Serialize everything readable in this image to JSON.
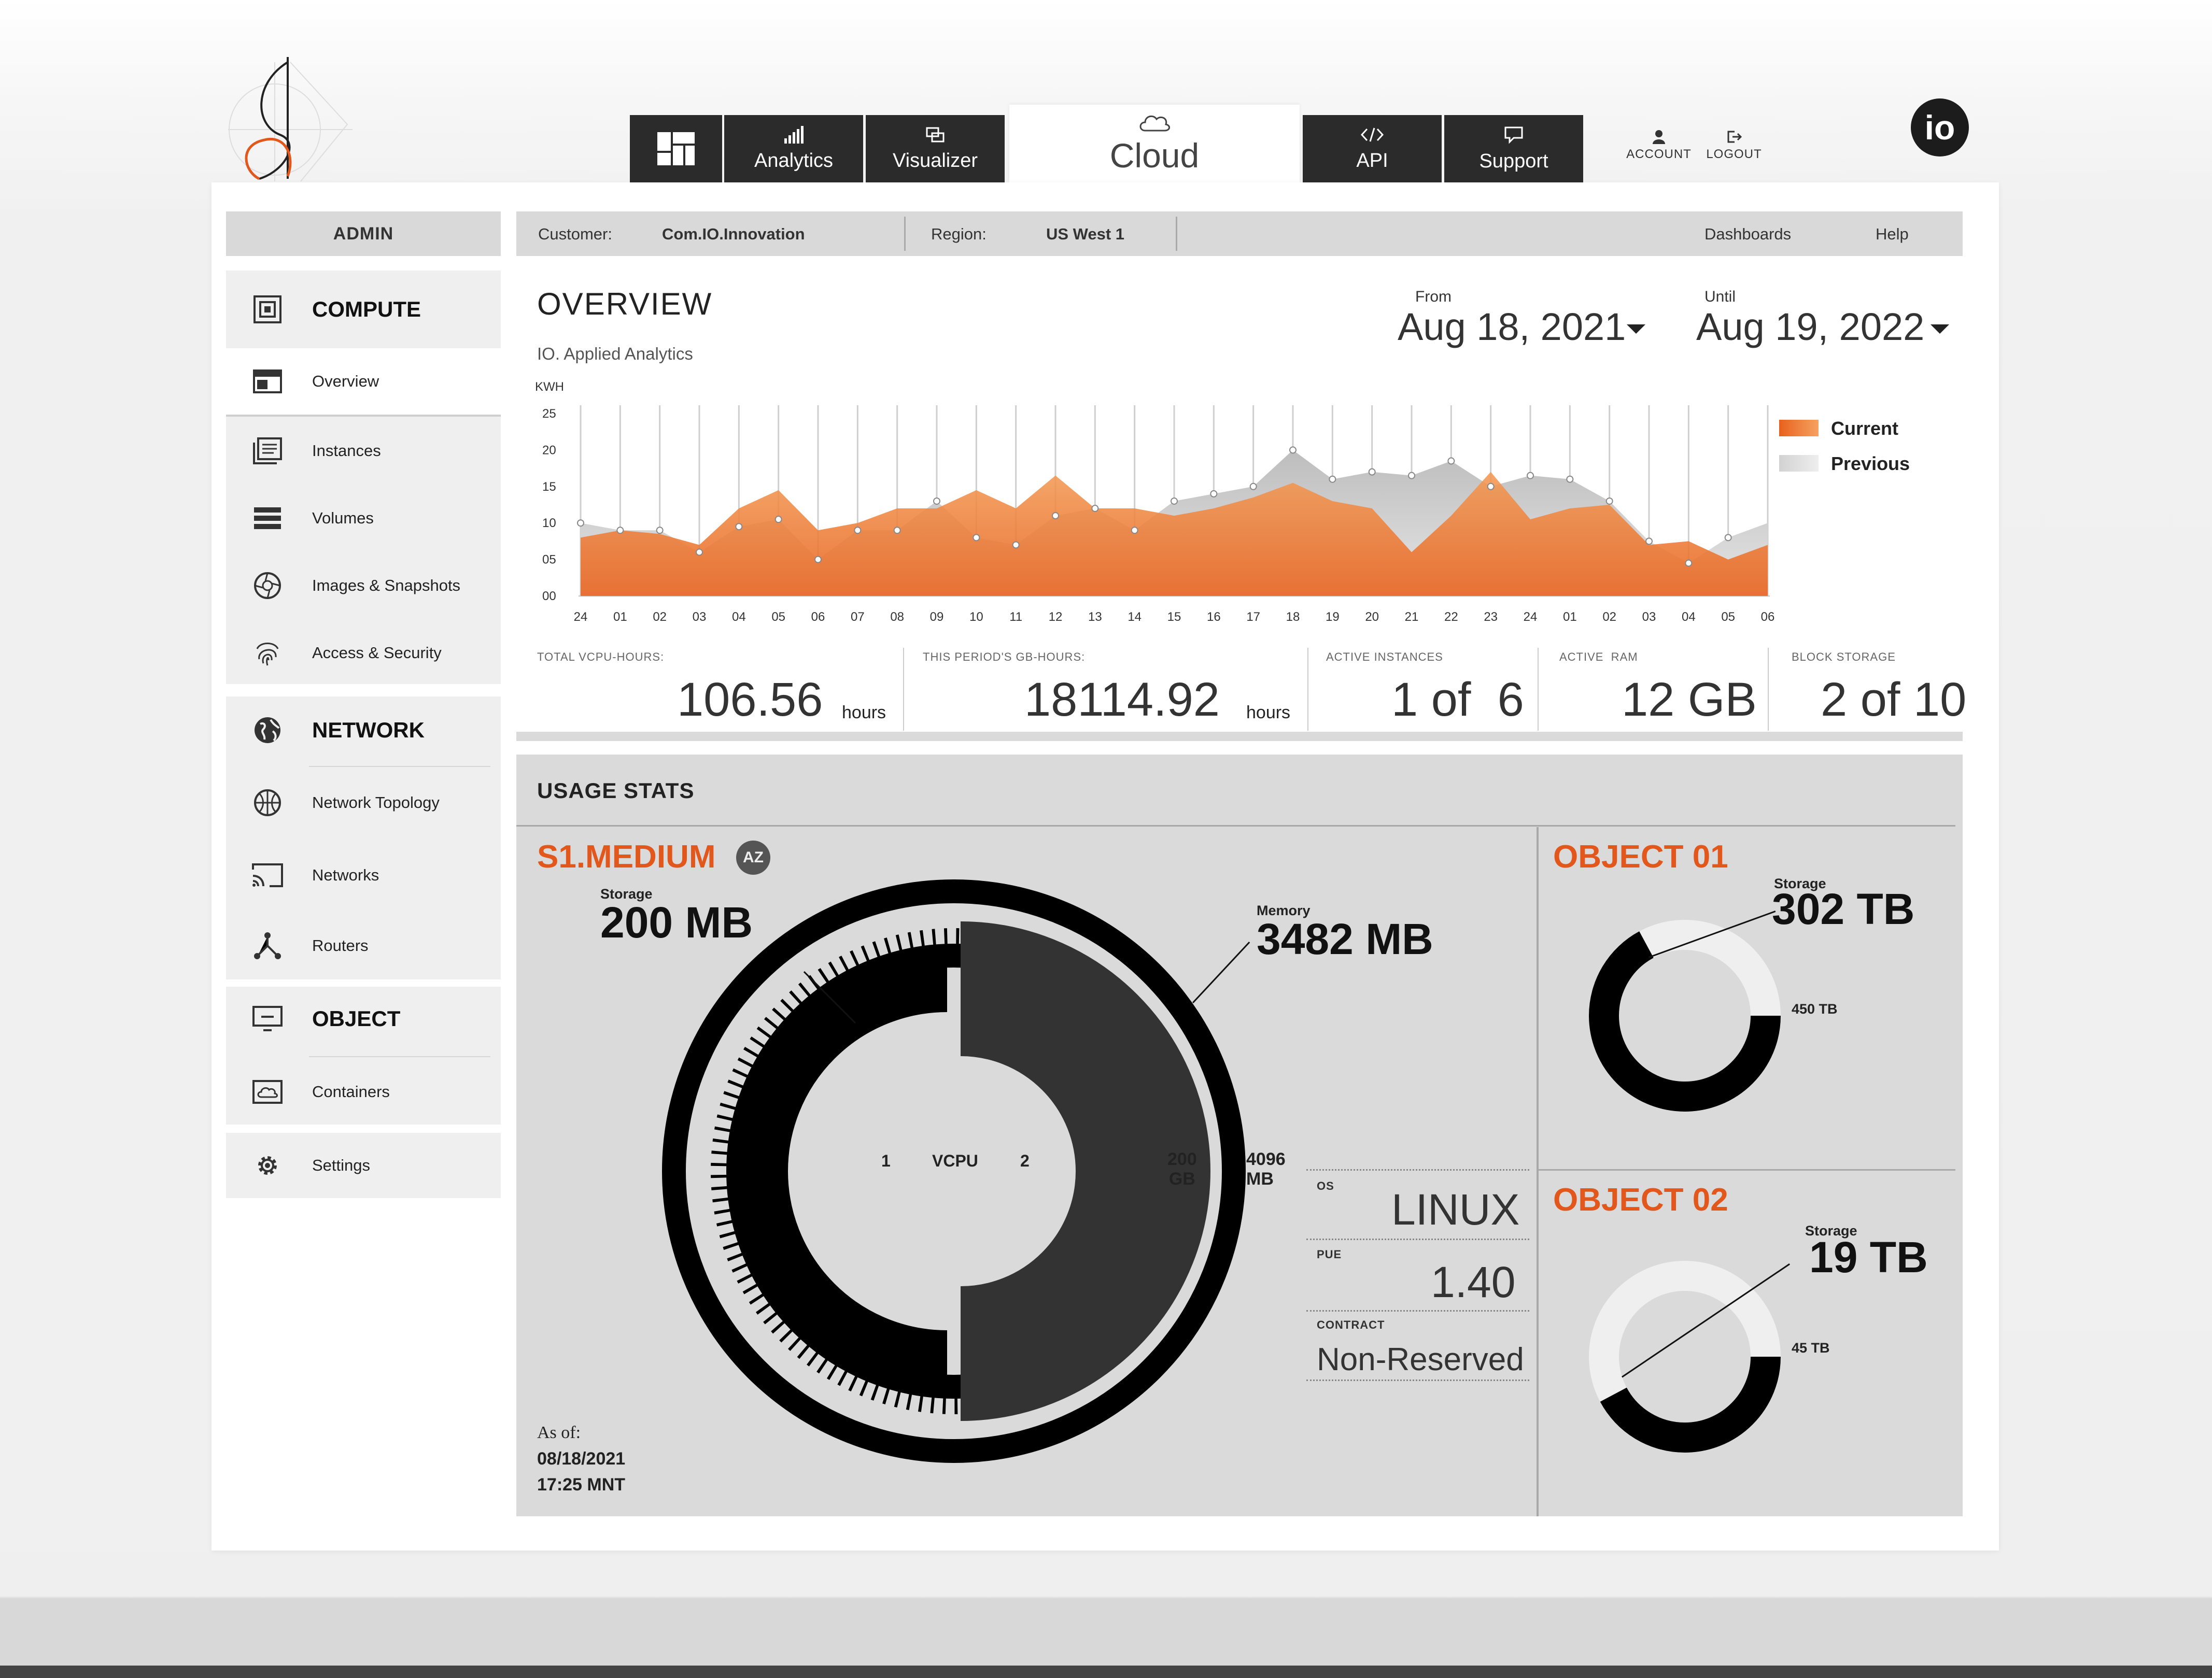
{
  "nav": {
    "tabs": [
      {
        "label": ""
      },
      {
        "label": "Analytics"
      },
      {
        "label": "Visualizer"
      },
      {
        "label": "Cloud"
      },
      {
        "label": "API"
      },
      {
        "label": "Support"
      }
    ],
    "account": "ACCOUNT",
    "logout": "LOGOUT",
    "brand_badge": "io"
  },
  "sidebar": {
    "header": "ADMIN",
    "compute": {
      "label": "COMPUTE",
      "items": [
        "Overview",
        "Instances",
        "Volumes",
        "Images & Snapshots",
        "Access & Security"
      ]
    },
    "network": {
      "label": "NETWORK",
      "items": [
        "Network Topology",
        "Networks",
        "Routers"
      ]
    },
    "object": {
      "label": "OBJECT",
      "items": [
        "Containers"
      ]
    },
    "settings": "Settings"
  },
  "infobar": {
    "customer_label": "Customer:",
    "customer_value": "Com.IO.Innovation",
    "region_label": "Region:",
    "region_value": "US West 1",
    "dashboards": "Dashboards",
    "help": "Help"
  },
  "overview": {
    "title": "OVERVIEW",
    "subtitle": "IO. Applied Analytics",
    "from_label": "From",
    "from_value": "Aug 18, 2021",
    "until_label": "Until",
    "until_value": "Aug 19, 2022"
  },
  "chart_data": {
    "type": "area",
    "ylabel": "KWH",
    "yticks": [
      "25",
      "20",
      "15",
      "10",
      "05",
      "00"
    ],
    "ylim": [
      0,
      25
    ],
    "x": [
      "24",
      "01",
      "02",
      "03",
      "04",
      "05",
      "06",
      "07",
      "08",
      "09",
      "10",
      "11",
      "12",
      "13",
      "14",
      "15",
      "16",
      "17",
      "18",
      "19",
      "20",
      "21",
      "22",
      "23",
      "24",
      "01",
      "02",
      "03",
      "04",
      "05",
      "06"
    ],
    "series": [
      {
        "name": "Current",
        "color": "#f07a2a",
        "values": [
          8,
          9,
          8.5,
          7,
          12,
          14.5,
          9,
          10,
          12,
          12,
          14.5,
          12,
          16.5,
          12,
          12,
          11,
          12,
          13.5,
          15.5,
          13,
          12,
          6,
          11,
          17,
          10.5,
          12,
          12.5,
          7,
          7.5,
          5,
          7
        ]
      },
      {
        "name": "Previous",
        "color": "#c9c9c9",
        "values": [
          10,
          9,
          9,
          6,
          9.5,
          10.5,
          5,
          9,
          9,
          13,
          8,
          7,
          11,
          12,
          9,
          13,
          14,
          15,
          20,
          16,
          17,
          16.5,
          18.5,
          15,
          16.5,
          16,
          13,
          7.5,
          4.5,
          8,
          10
        ]
      }
    ],
    "grid": true,
    "legend": "right"
  },
  "stats": [
    {
      "label": "TOTAL VCPU-HOURS:",
      "value": "106.56",
      "unit": "hours"
    },
    {
      "label": "THIS PERIOD'S GB-HOURS:",
      "value": "18114.92",
      "unit": "hours"
    },
    {
      "label": "ACTIVE INSTANCES",
      "value": "1 of  6",
      "unit": ""
    },
    {
      "label": "ACTIVE  RAM",
      "value": "12 GB",
      "unit": ""
    },
    {
      "label": "BLOCK STORAGE",
      "value": "2 of 10",
      "unit": ""
    }
  ],
  "usage": {
    "title": "USAGE STATS",
    "instance": "S1.MEDIUM",
    "az_badge": "AZ",
    "storage_label": "Storage",
    "storage_value": "200 MB",
    "storage_total_num": "200",
    "storage_total_unit": "GB",
    "memory_label": "Memory",
    "memory_value": "3482 MB",
    "memory_total_num": "4096",
    "memory_total_unit": "MB",
    "vcpu_label": "VCPU",
    "vcpu_used": "1",
    "vcpu_total": "2",
    "as_of_label": "As of:",
    "as_of_date": "08/18/2021",
    "as_of_time": "17:25 MNT",
    "os_label": "OS",
    "os_value": "LINUX",
    "pue_label": "PUE",
    "pue_value": "1.40",
    "contract_label": "CONTRACT",
    "contract_value": "Non-Reserved",
    "object1": {
      "title": "OBJECT 01",
      "storage_label": "Storage",
      "used": "302 TB",
      "total": "450 TB",
      "fraction": 0.671
    },
    "object2": {
      "title": "OBJECT 02",
      "storage_label": "Storage",
      "used": "19 TB",
      "total": "45 TB",
      "fraction": 0.422
    }
  }
}
